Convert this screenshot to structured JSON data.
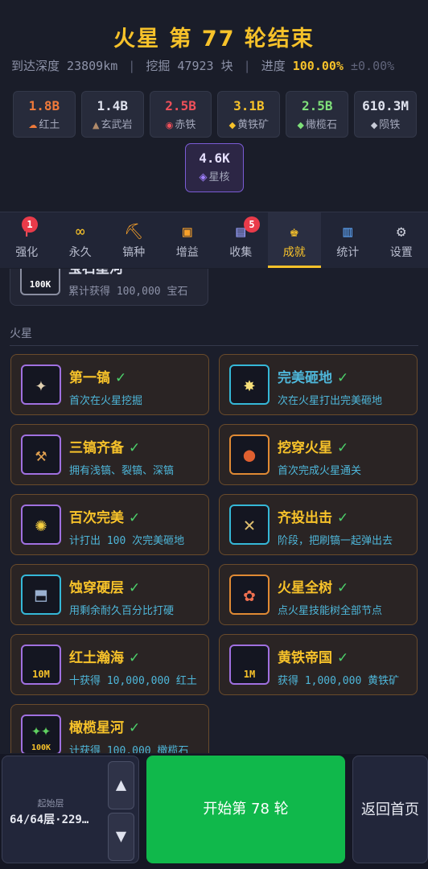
{
  "header": {
    "title": "火星 第 77 轮结束",
    "depth_label": "到达深度",
    "depth_value": "23809km",
    "dig_label": "挖掘",
    "dig_value": "47923",
    "dig_unit": "块",
    "progress_label": "进度",
    "progress_value": "100.00%",
    "progress_delta": "±0.00%"
  },
  "resources": [
    {
      "value": "1.8B",
      "name": "红土",
      "color": "#f07a3a",
      "icon": "🜁"
    },
    {
      "value": "1.4B",
      "name": "玄武岩",
      "color": "#dfe2ee",
      "icon": "▲"
    },
    {
      "value": "2.5B",
      "name": "赤铁",
      "color": "#f0505a",
      "icon": "◉"
    },
    {
      "value": "3.1B",
      "name": "黄铁矿",
      "color": "#f7c22a",
      "icon": "◆"
    },
    {
      "value": "2.5B",
      "name": "橄榄石",
      "color": "#7fe07a",
      "icon": "◆"
    },
    {
      "value": "610.3M",
      "name": "陨铁",
      "color": "#dfe2ee",
      "icon": "◆"
    }
  ],
  "core": {
    "value": "4.6K",
    "name": "星核",
    "icon": "◈"
  },
  "nav": [
    {
      "label": "强化",
      "icon": "↑",
      "badge": "1"
    },
    {
      "label": "永久",
      "icon": "∞",
      "badge": ""
    },
    {
      "label": "镐种",
      "icon": "⸕",
      "badge": ""
    },
    {
      "label": "增益",
      "icon": "▣",
      "badge": ""
    },
    {
      "label": "收集",
      "icon": "▤",
      "badge": "5"
    },
    {
      "label": "成就",
      "icon": "♚",
      "badge": ""
    },
    {
      "label": "统计",
      "icon": "▥",
      "badge": ""
    },
    {
      "label": "设置",
      "icon": "⚙",
      "badge": ""
    }
  ],
  "top_card": {
    "title": "宝石星河",
    "desc": "累计获得 100,000 宝石",
    "badge": "100K"
  },
  "section": "火星",
  "achievements": [
    {
      "title": "第一镐",
      "desc": "首次在火星挖掘",
      "check": "✓"
    },
    {
      "title": "完美砸地",
      "desc": "次在火星打出完美砸地",
      "check": "✓"
    },
    {
      "title": "三镐齐备",
      "desc": "拥有浅镐、裂镐、深镐",
      "check": "✓"
    },
    {
      "title": "挖穿火星",
      "desc": "首次完成火星通关",
      "check": "✓"
    },
    {
      "title": "百次完美",
      "desc": "计打出 100 次完美砸地",
      "check": "✓"
    },
    {
      "title": "齐投出击",
      "desc": "阶段，把刷镐一起弹出去",
      "check": "✓"
    },
    {
      "title": "蚀穿硬层",
      "desc": "用剩余耐久百分比打硬",
      "check": "✓"
    },
    {
      "title": "火星全树",
      "desc": "点火星技能树全部节点",
      "check": "✓"
    },
    {
      "title": "红土瀚海",
      "desc": "十获得 10,000,000 红土",
      "check": "✓",
      "badge": "10M"
    },
    {
      "title": "黄铁帝国",
      "desc": "获得 1,000,000 黄铁矿",
      "check": "✓",
      "badge": "1M"
    },
    {
      "title": "橄榄星河",
      "desc": "计获得 100,000 橄榄石",
      "check": "✓",
      "badge": "100K"
    }
  ],
  "bottom": {
    "start_label": "起始层",
    "start_value": "64/64层·229…",
    "up": "▲",
    "down": "▼",
    "go_label": "开始第 78 轮",
    "home_label": "返回首页"
  }
}
